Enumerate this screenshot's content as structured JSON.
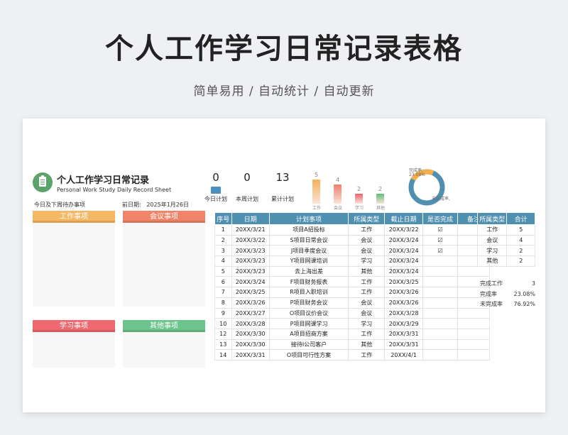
{
  "hero": {
    "title": "个人工作学习日常记录表格",
    "subtitle": "简单易用 / 自动统计 / 自动更新"
  },
  "sheet": {
    "title": "个人工作学习日常记录表",
    "subtitle": "Personal Work Study Daily Record Sheet",
    "todo_label": "今日及下周待办事项",
    "date_label": "前日期:",
    "date_value": "2025年1月26日"
  },
  "stats": [
    {
      "value": "0",
      "label": "今日计划"
    },
    {
      "value": "0",
      "label": "本周计划"
    },
    {
      "value": "13",
      "label": "累计计划"
    }
  ],
  "bar_chart": {
    "categories": [
      "工作",
      "会议",
      "学习",
      "其他"
    ],
    "values": [
      5,
      4,
      2,
      2
    ],
    "colors": [
      "#f5b05a",
      "#ef7d6c",
      "#e9636f",
      "#5bbf7a"
    ]
  },
  "donut": {
    "completed_label": "完成率,",
    "completed_value": "23.08%",
    "incomplete_label": "未完成率,",
    "completed_fraction": 0.2308,
    "color_done": "#f3b04c",
    "color_todo": "#4f8fb0"
  },
  "categories": [
    {
      "name": "工作事项",
      "color": "#f5b965"
    },
    {
      "name": "会议事项",
      "color": "#ef8469"
    },
    {
      "name": "学习事项",
      "color": "#ee6a70"
    },
    {
      "name": "其他事项",
      "color": "#6cc38b"
    }
  ],
  "table": {
    "headers": [
      "序号",
      "日期",
      "计划事项",
      "所属类型",
      "截止日期",
      "是否完成",
      "备注"
    ],
    "rows": [
      [
        "1",
        "20XX/3/21",
        "项目A招投标",
        "工作",
        "20XX/3/22",
        "☑",
        ""
      ],
      [
        "2",
        "20XX/3/22",
        "S项目日常会议",
        "会议",
        "20XX/3/24",
        "☑",
        ""
      ],
      [
        "3",
        "20XX/3/23",
        "J项目季度会议",
        "会议",
        "20XX/3/24",
        "☑",
        ""
      ],
      [
        "4",
        "20XX/3/23",
        "Y项目网课培训",
        "学习",
        "20XX/3/24",
        "",
        ""
      ],
      [
        "5",
        "20XX/3/23",
        "去上海出差",
        "其他",
        "20XX/3/24",
        "",
        ""
      ],
      [
        "6",
        "20XX/3/24",
        "F项目财务报表",
        "工作",
        "20XX/3/25",
        "",
        ""
      ],
      [
        "7",
        "20XX/3/25",
        "R项目入职培训",
        "工作",
        "20XX/3/26",
        "",
        ""
      ],
      [
        "8",
        "20XX/3/26",
        "P项目财务会议",
        "会议",
        "20XX/3/26",
        "",
        ""
      ],
      [
        "9",
        "20XX/3/27",
        "O项目议价会议",
        "会议",
        "20XX/3/28",
        "",
        ""
      ],
      [
        "10",
        "20XX/3/28",
        "P项目网课学习",
        "学习",
        "20XX/3/29",
        "",
        ""
      ],
      [
        "12",
        "20XX/3/30",
        "A项目招商方案",
        "工作",
        "20XX/3/31",
        "",
        ""
      ],
      [
        "13",
        "20XX/3/30",
        "接待I公司客户",
        "其他",
        "20XX/3/31",
        "",
        ""
      ],
      [
        "14",
        "20XX/3/31",
        "O项目可行性方案",
        "工作",
        "20XX/4/1",
        "",
        ""
      ]
    ]
  },
  "side_table": {
    "headers": [
      "所属类型",
      "合计"
    ],
    "rows": [
      [
        "工作",
        "5"
      ],
      [
        "会议",
        "4"
      ],
      [
        "学习",
        "2"
      ],
      [
        "其他",
        "2"
      ]
    ]
  },
  "summary": [
    {
      "label": "完成工作",
      "value": "3"
    },
    {
      "label": "完成率",
      "value": "23.08%"
    },
    {
      "label": "未完成率",
      "value": "76.92%"
    }
  ]
}
